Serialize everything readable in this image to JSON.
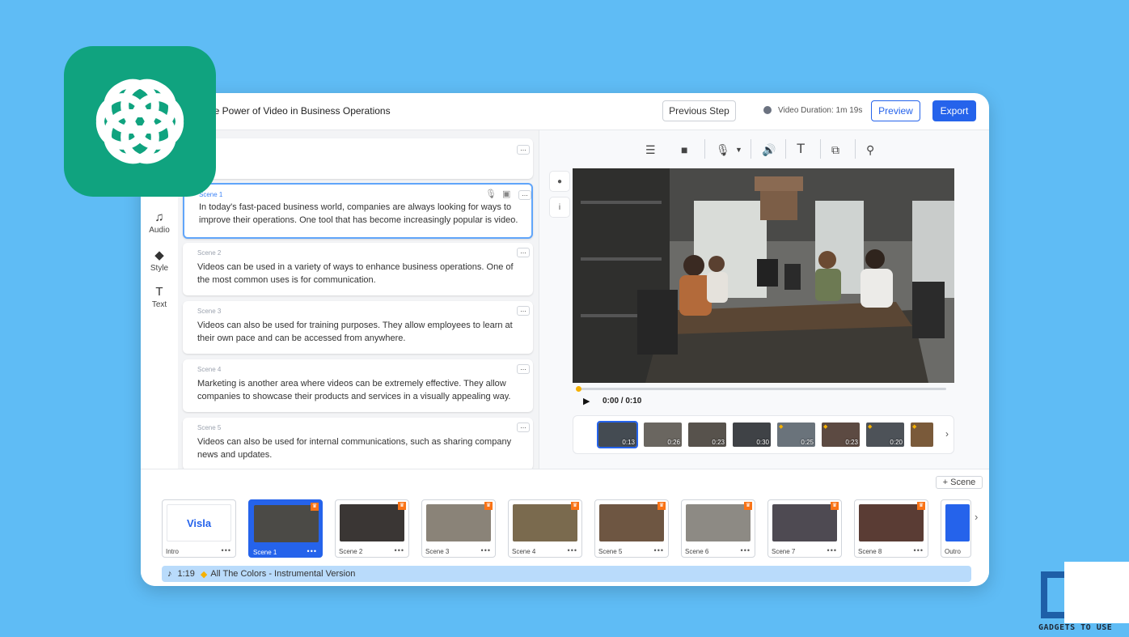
{
  "header": {
    "project_title": "he Power of Video in Business Operations",
    "previous_step": "Previous Step",
    "video_duration": "Video Duration: 1m 19s",
    "preview": "Preview",
    "export": "Export"
  },
  "sidebar": {
    "items": [
      {
        "label": "Audio",
        "icon": "music-note-icon"
      },
      {
        "label": "Style",
        "icon": "paint-bucket-icon"
      },
      {
        "label": "Text",
        "icon": "text-icon"
      }
    ]
  },
  "scenes": [
    {
      "label": "Scene 1",
      "text": "In today's fast-paced business world, companies are always looking for ways to improve their operations. One tool that has become increasingly popular is video.",
      "active": true
    },
    {
      "label": "Scene 2",
      "text": "Videos can be used in a variety of ways to enhance business operations. One of the most common uses is for communication.",
      "active": false
    },
    {
      "label": "Scene 3",
      "text": "Videos can also be used for training purposes. They allow employees to learn at their own pace and can be accessed from anywhere.",
      "active": false
    },
    {
      "label": "Scene 4",
      "text": "Marketing is another area where videos can be extremely effective. They allow companies to showcase their products and services in a visually appealing way.",
      "active": false
    },
    {
      "label": "Scene 5",
      "text": "Videos can also be used for internal communications, such as sharing company news and updates.",
      "active": false
    }
  ],
  "player": {
    "timecode": "0:00 / 0:10",
    "progress": 0
  },
  "clips": [
    "0:13",
    "0:26",
    "0:23",
    "0:30",
    "0:25",
    "0:23",
    "0:20",
    ""
  ],
  "timeline": {
    "add_scene": "Scene",
    "cards": [
      {
        "label": "Intro",
        "logo": "Visla"
      },
      {
        "label": "Scene 1",
        "selected": true
      },
      {
        "label": "Scene 2"
      },
      {
        "label": "Scene 3"
      },
      {
        "label": "Scene 4"
      },
      {
        "label": "Scene 5"
      },
      {
        "label": "Scene 6"
      },
      {
        "label": "Scene 7"
      },
      {
        "label": "Scene 8"
      },
      {
        "label": "Outro"
      }
    ],
    "music": {
      "time": "1:19",
      "title": "All The Colors - Instrumental Version"
    }
  },
  "watermark": "GADGETS TO USE",
  "colors": {
    "background": "#5fbcf5",
    "accent": "#2563eb",
    "chatgpt_green": "#10a37f",
    "music_bar": "#b9dbfb"
  }
}
